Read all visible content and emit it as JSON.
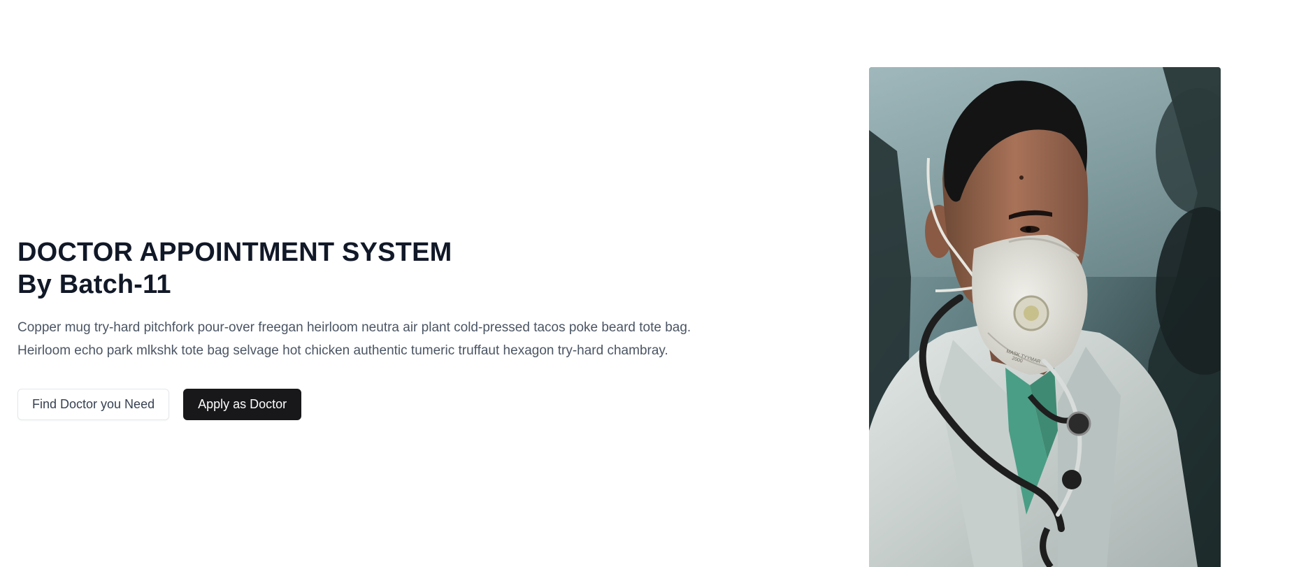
{
  "hero": {
    "title_line1": "DOCTOR APPOINTMENT SYSTEM",
    "title_line2": "By Batch-11",
    "description_line1": "Copper mug try-hard pitchfork pour-over freegan heirloom neutra air plant cold-pressed tacos poke beard tote bag.",
    "description_line2": "Heirloom echo park mlkshk tote bag selvage hot chicken authentic tumeric truffaut hexagon try-hard chambray.",
    "buttons": {
      "find_doctor": "Find Doctor you Need",
      "apply_doctor": "Apply as Doctor"
    }
  },
  "image": {
    "subject": "doctor-wearing-mask-with-stethoscope",
    "mask_text_line1": "MASK TYYMAR",
    "mask_text_line2": "2000"
  },
  "colors": {
    "title": "#111827",
    "text": "#4b5563",
    "button_dark": "#18181b",
    "background": "#ffffff"
  }
}
